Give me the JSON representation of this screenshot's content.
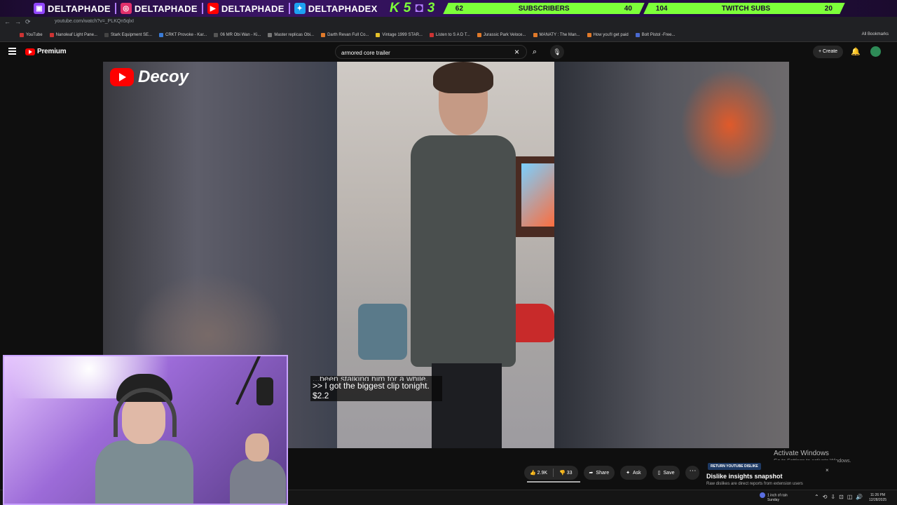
{
  "overlay": {
    "socials": [
      {
        "icon": "twitch-icon",
        "handle": "DELTAPHADE",
        "color": "#9146ff"
      },
      {
        "icon": "instagram-icon",
        "handle": "DELTAPHADE",
        "color": "#e1306c"
      },
      {
        "icon": "youtube-icon",
        "handle": "DELTAPHADE",
        "color": "#ff0000"
      },
      {
        "icon": "twitter-icon",
        "handle": "DELTAPHADEX",
        "color": "#1da1f2"
      }
    ],
    "k_count": "5",
    "twitch_count": "3",
    "subscribers": {
      "left": "62",
      "label": "SUBSCRIBERS",
      "right": "40"
    },
    "twitch_subs": {
      "left": "104",
      "label": "TWITCH SUBS",
      "right": "20"
    }
  },
  "browser": {
    "url": "youtube.com/watch?v=_PLKQn5qlxI",
    "bookmarks": [
      "YouTube",
      "Nanoleaf Light Pane...",
      "Stark Equipment SE...",
      "CRKT Provoke - Kar...",
      "06 MR Obi Wan - Ki...",
      "Master replicas Obi...",
      "Darth Revan Full Co...",
      "Vintage 1999 STAR...",
      "Listen to S A D T...",
      "Jurassic Park Veloce...",
      "MANATY : The Man...",
      "How you'll get paid",
      "Bolt Pistol -Free..."
    ],
    "all_bookmarks": "All Bookmarks"
  },
  "youtube": {
    "logo_text": "Premium",
    "search_value": "armored core trailer",
    "create_label": "Create",
    "channel_wordmark": "Decoy",
    "caption_cut": "...been stalking him for a while.",
    "caption_line1": ">> I got the biggest clip tonight.",
    "caption_line2": "$2.2",
    "likes": "2.9K",
    "dislikes": "33",
    "share": "Share",
    "ask": "Ask",
    "save": "Save"
  },
  "dislike_popup": {
    "badge": "RETURN YOUTUBE DISLIKE",
    "title": "Dislike insights snapshot",
    "subtitle": "Raw dislikes are direct reports from extension users"
  },
  "windows": {
    "activate_title": "Activate Windows",
    "activate_sub": "Go to Settings to activate Windows.",
    "weather_line1": "1 inch of rain",
    "weather_line2": "Sunday",
    "time": "11:26 PM",
    "date": "12/28/2025"
  }
}
